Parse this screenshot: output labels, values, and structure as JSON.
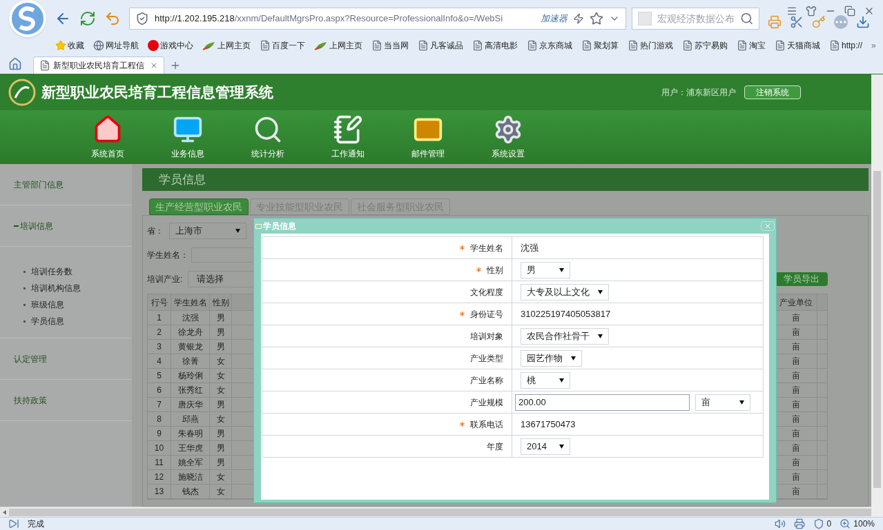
{
  "browser": {
    "url_host": "http://1.202.195.218",
    "url_path": "/xxnm/DefaultMgrsPro.aspx?Resource=ProfessionalInfo&o=/WebSi",
    "accelerator": "加速器",
    "search_placeholder": "宏观经济数据公布",
    "bookmarks": [
      {
        "kind": "star",
        "label": "收藏"
      },
      {
        "kind": "globe",
        "label": "网址导航"
      },
      {
        "kind": "game",
        "label": "游戏中心"
      },
      {
        "kind": "hao",
        "label": "上网主页"
      },
      {
        "kind": "page",
        "label": "百度一下"
      },
      {
        "kind": "hao",
        "label": "上网主页"
      },
      {
        "kind": "page",
        "label": "当当网"
      },
      {
        "kind": "page",
        "label": "凡客诚品"
      },
      {
        "kind": "page",
        "label": "高清电影"
      },
      {
        "kind": "page",
        "label": "京东商城"
      },
      {
        "kind": "page",
        "label": "聚划算"
      },
      {
        "kind": "page",
        "label": "热门游戏"
      },
      {
        "kind": "page",
        "label": "苏宁易购"
      },
      {
        "kind": "page",
        "label": "淘宝"
      },
      {
        "kind": "page",
        "label": "天猫商城"
      },
      {
        "kind": "page",
        "label": "http://"
      }
    ],
    "more": "»",
    "tab_title": "新型职业农民培育工程信",
    "status": "完成",
    "blocked_count": "0",
    "zoom": "100%"
  },
  "app": {
    "title": "新型职业农民培育工程信息管理系统",
    "user": "用户：浦东新区用户",
    "logout": "注销系统",
    "nav": [
      {
        "kind": "home",
        "label": "系统首页"
      },
      {
        "kind": "monitor",
        "label": "业务信息"
      },
      {
        "kind": "search",
        "label": "统计分析"
      },
      {
        "kind": "notepad",
        "label": "工作通知"
      },
      {
        "kind": "mail",
        "label": "邮件管理"
      },
      {
        "kind": "gear",
        "label": "系统设置"
      }
    ],
    "sidebar": [
      {
        "label": "主管部门信息",
        "expanded": false
      },
      {
        "label": "培训信息",
        "expanded": true,
        "children": [
          {
            "label": "培训任务数"
          },
          {
            "label": "培训机构信息"
          },
          {
            "label": "班级信息"
          },
          {
            "label": "学员信息"
          }
        ]
      },
      {
        "label": "认定管理",
        "expanded": false
      },
      {
        "label": "扶持政策",
        "expanded": false
      }
    ],
    "page_title": "学员信息",
    "tabs": [
      {
        "label": "生产经营型职业农民",
        "selected": true
      },
      {
        "label": "专业技能型职业农民",
        "selected": false
      },
      {
        "label": "社会服务型职业农民",
        "selected": false
      }
    ],
    "filters": {
      "province_label": "省：",
      "province": "上海市",
      "name_label": "学生姓名：",
      "industry_label": "培训产业:",
      "industry": "请选择"
    },
    "export_button": "学员导出",
    "table": {
      "columns": [
        "行号",
        "学生姓名",
        "性别"
      ],
      "last_column": "产业单位",
      "rows": [
        {
          "no": "1",
          "name": "沈强",
          "gender": "男",
          "unit": "亩"
        },
        {
          "no": "2",
          "name": "徐龙舟",
          "gender": "男",
          "unit": "亩"
        },
        {
          "no": "3",
          "name": "黄银龙",
          "gender": "男",
          "unit": "亩"
        },
        {
          "no": "4",
          "name": "徐菁",
          "gender": "女",
          "unit": "亩"
        },
        {
          "no": "5",
          "name": "杨玲俐",
          "gender": "女",
          "unit": "亩"
        },
        {
          "no": "6",
          "name": "张秀红",
          "gender": "女",
          "unit": "亩"
        },
        {
          "no": "7",
          "name": "唐庆华",
          "gender": "男",
          "unit": "亩"
        },
        {
          "no": "8",
          "name": "邱燕",
          "gender": "女",
          "unit": "亩"
        },
        {
          "no": "9",
          "name": "朱春明",
          "gender": "男",
          "unit": "亩"
        },
        {
          "no": "10",
          "name": "王华虎",
          "gender": "男",
          "unit": "亩"
        },
        {
          "no": "11",
          "name": "姚全军",
          "gender": "男",
          "unit": "亩"
        },
        {
          "no": "12",
          "name": "施晓洁",
          "gender": "女",
          "unit": "亩"
        },
        {
          "no": "13",
          "name": "钱杰",
          "gender": "女",
          "unit": "亩"
        }
      ]
    }
  },
  "dialog": {
    "title": "学员信息",
    "fields": [
      {
        "kind": "text",
        "label": "学生姓名",
        "required": true,
        "value": "沈强"
      },
      {
        "kind": "select",
        "label": "性别",
        "required": true,
        "value": "男"
      },
      {
        "kind": "select",
        "label": "文化程度",
        "required": false,
        "value": "大专及以上文化"
      },
      {
        "kind": "text",
        "label": "身份证号",
        "required": true,
        "value": "310225197405053817"
      },
      {
        "kind": "select",
        "label": "培训对象",
        "required": false,
        "value": "农民合作社骨干"
      },
      {
        "kind": "select",
        "label": "产业类型",
        "required": false,
        "value": "园艺作物"
      },
      {
        "kind": "select",
        "label": "产业名称",
        "required": false,
        "value": "桃"
      },
      {
        "kind": "input_unit",
        "label": "产业规模",
        "required": false,
        "value": "200.00",
        "unit": "亩"
      },
      {
        "kind": "text",
        "label": "联系电话",
        "required": true,
        "value": "13671750473"
      },
      {
        "kind": "select",
        "label": "年度",
        "required": false,
        "value": "2014"
      }
    ]
  }
}
